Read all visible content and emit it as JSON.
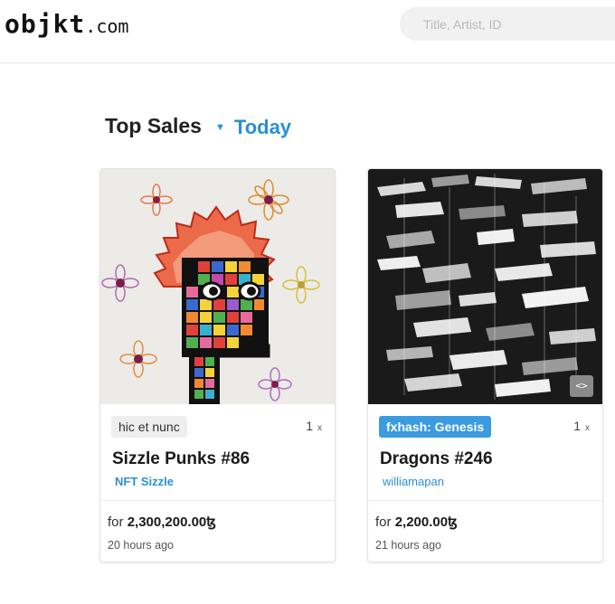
{
  "header": {
    "logo_main": "objkt",
    "logo_domain": ".com",
    "search_placeholder": "Title, Artist, ID"
  },
  "section": {
    "title": "Top Sales",
    "period": "Today"
  },
  "cards": [
    {
      "marketplace": "hic et nunc",
      "quantity": "1",
      "quantity_unit": "x",
      "name": "Sizzle Punks #86",
      "creator": "NFT Sizzle",
      "price_prefix": "for",
      "price": "2,300,200.00ꜩ",
      "time": "20 hours ago"
    },
    {
      "marketplace": "fxhash: Genesis",
      "quantity": "1",
      "quantity_unit": "x",
      "name": "Dragons #246",
      "creator": "williamapan",
      "price_prefix": "for",
      "price": "2,200.00ꜩ",
      "time": "21 hours ago"
    }
  ]
}
